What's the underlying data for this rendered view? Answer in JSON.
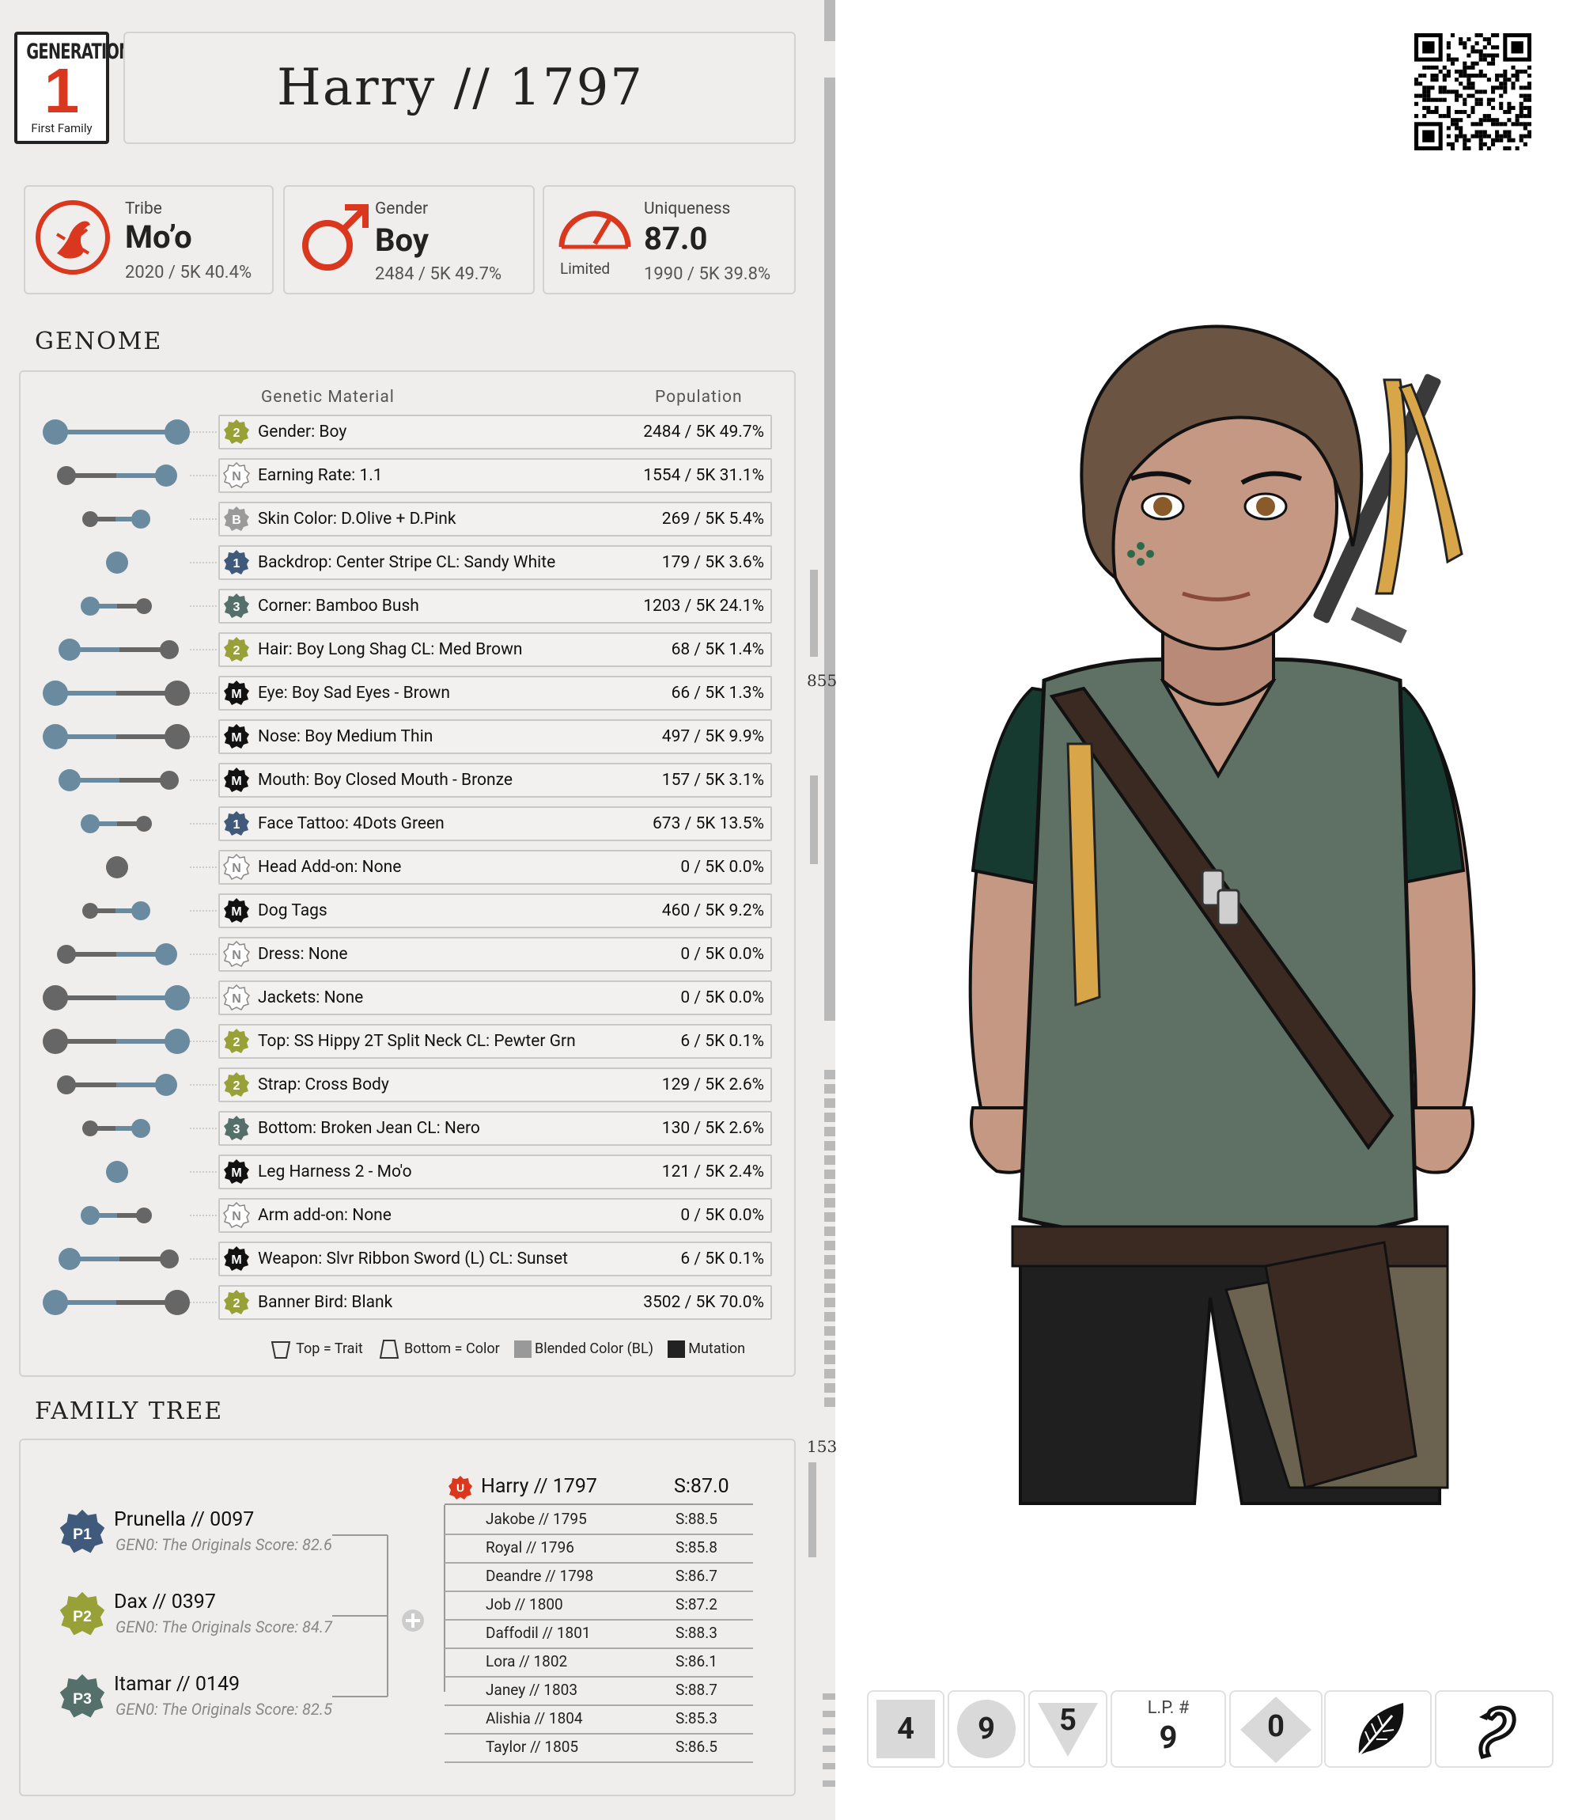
{
  "generation": {
    "label": "GENERATION",
    "number": "1",
    "subtitle": "First Family"
  },
  "title": "Harry  //  1797",
  "stats": {
    "tribe": {
      "label": "Tribe",
      "value": "Mo’o",
      "sub": "2020 / 5K  40.4%"
    },
    "gender": {
      "label": "Gender",
      "value": "Boy",
      "sub": "2484 / 5K  49.7%"
    },
    "uniqueness": {
      "label": "Uniqueness",
      "value": "87.0",
      "badge": "Limited",
      "sub": "1990 / 5K  39.8%"
    }
  },
  "genome": {
    "section_title": "GENOME",
    "col_material": "Genetic Material",
    "col_population": "Population",
    "rows": [
      {
        "badge": "2",
        "trait": "Gender: Boy",
        "pop": "2484 / 5K   49.7%"
      },
      {
        "badge": "N",
        "trait": "Earning Rate: 1.1",
        "pop": "1554 / 5K   31.1%"
      },
      {
        "badge": "B",
        "trait": "Skin Color: D.Olive + D.Pink",
        "pop": "269 / 5K     5.4%"
      },
      {
        "badge": "1",
        "trait": "Backdrop: Center Stripe CL: Sandy White",
        "pop": "179 / 5K     3.6%"
      },
      {
        "badge": "3",
        "trait": "Corner: Bamboo Bush",
        "pop": "1203 / 5K   24.1%"
      },
      {
        "badge": "2",
        "trait": "Hair: Boy Long Shag CL: Med Brown",
        "pop": "68 / 5K     1.4%"
      },
      {
        "badge": "M",
        "trait": "Eye: Boy Sad Eyes - Brown",
        "pop": "66 / 5K     1.3%"
      },
      {
        "badge": "M",
        "trait": "Nose: Boy Medium Thin",
        "pop": "497 / 5K     9.9%"
      },
      {
        "badge": "M",
        "trait": "Mouth: Boy Closed Mouth - Bronze",
        "pop": "157 / 5K     3.1%"
      },
      {
        "badge": "1",
        "trait": "Face Tattoo: 4Dots Green",
        "pop": "673 / 5K   13.5%"
      },
      {
        "badge": "N",
        "trait": "Head Add-on:  None",
        "pop": "0 / 5K     0.0%"
      },
      {
        "badge": "M",
        "trait": "Dog Tags",
        "pop": "460 / 5K     9.2%"
      },
      {
        "badge": "N",
        "trait": "Dress: None",
        "pop": "0 / 5K     0.0%"
      },
      {
        "badge": "N",
        "trait": "Jackets: None",
        "pop": "0 / 5K     0.0%"
      },
      {
        "badge": "2",
        "trait": "Top: SS Hippy 2T Split Neck CL: Pewter Grn",
        "pop": "6 / 5K     0.1%"
      },
      {
        "badge": "2",
        "trait": "Strap: Cross Body",
        "pop": "129 / 5K     2.6%"
      },
      {
        "badge": "3",
        "trait": "Bottom: Broken Jean CL: Nero",
        "pop": "130 / 5K     2.6%"
      },
      {
        "badge": "M",
        "trait": "Leg Harness 2 - Mo'o",
        "pop": "121 / 5K     2.4%"
      },
      {
        "badge": "N",
        "trait": "Arm add-on: None",
        "pop": "0 / 5K     0.0%"
      },
      {
        "badge": "M",
        "trait": "Weapon: Slvr Ribbon Sword (L) CL: Sunset",
        "pop": "6 / 5K     0.1%"
      },
      {
        "badge": "2",
        "trait": "Banner Bird:  Blank",
        "pop": "3502 / 5K   70.0%"
      }
    ],
    "legend": {
      "top": "Top = Trait",
      "bottom": "Bottom = Color",
      "blended": "Blended Color (BL)",
      "mutation": "Mutation"
    }
  },
  "family_tree": {
    "section_title": "FAMILY TREE",
    "parents": [
      {
        "badge": "P1",
        "name": "Prunella  //  0097",
        "sub": "GEN0: The Originals Score: 82.6",
        "color": "#3f5a7a"
      },
      {
        "badge": "P2",
        "name": "Dax  //  0397",
        "sub": "GEN0: The Originals Score: 84.7",
        "color": "#98a038"
      },
      {
        "badge": "P3",
        "name": "Itamar  //  0149",
        "sub": "GEN0: The Originals Score: 82.5",
        "color": "#55706a"
      }
    ],
    "self": {
      "badge": "U",
      "name": "Harry // 1797",
      "score": "S:87.0"
    },
    "siblings": [
      {
        "name": "Jakobe  //  1795",
        "score": "S:88.5"
      },
      {
        "name": "Royal  //  1796",
        "score": "S:85.8"
      },
      {
        "name": "Deandre  //  1798",
        "score": "S:86.7"
      },
      {
        "name": "Job  //  1800",
        "score": "S:87.2"
      },
      {
        "name": "Daffodil  //  1801",
        "score": "S:88.3"
      },
      {
        "name": "Lora  //  1802",
        "score": "S:86.1"
      },
      {
        "name": "Janey  //  1803",
        "score": "S:88.7"
      },
      {
        "name": "Alishia  //  1804",
        "score": "S:85.3"
      },
      {
        "name": "Taylor  //  1805",
        "score": "S:86.5"
      }
    ]
  },
  "scroll_labels": {
    "top": "855",
    "bottom": "153"
  },
  "bottom_tiles": {
    "square": "4",
    "circle": "9",
    "triangle": "5",
    "lp_label": "L.P. #",
    "lp_value": "9",
    "diamond": "0"
  },
  "colors": {
    "accent_red": "#d9381e",
    "dot_blue": "#6a8aa0",
    "dot_gray": "#666666"
  }
}
